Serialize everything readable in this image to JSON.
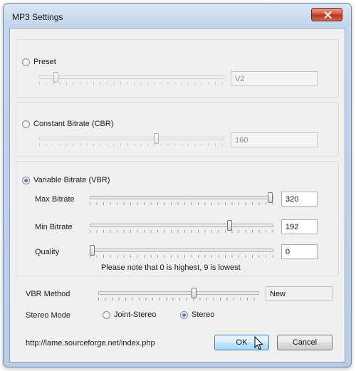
{
  "window": {
    "title": "MP3 Settings"
  },
  "preset": {
    "label": "Preset",
    "value": "V2",
    "slider_level": 0.08,
    "checked": false
  },
  "cbr": {
    "label": "Constant Bitrate (CBR)",
    "value": "160",
    "slider_level": 0.64,
    "checked": false
  },
  "vbr": {
    "label": "Variable Bitrate (VBR)",
    "checked": true,
    "max_bitrate": {
      "label": "Max Bitrate",
      "value": "320",
      "slider_level": 1.0
    },
    "min_bitrate": {
      "label": "Min Bitrate",
      "value": "192",
      "slider_level": 0.77
    },
    "quality": {
      "label": "Quality",
      "value": "0",
      "slider_level": 0.0
    },
    "note": "Please note that 0 is highest, 9 is lowest"
  },
  "vbr_method": {
    "label": "VBR Method",
    "value": "New",
    "slider_level": 0.6
  },
  "stereo_mode": {
    "label": "Stereo Mode",
    "options": [
      {
        "label": "Joint-Stereo",
        "checked": false
      },
      {
        "label": "Stereo",
        "checked": true
      }
    ]
  },
  "footer": {
    "link": "http://lame.sourceforge.net/index.php",
    "ok_label": "OK",
    "cancel_label": "Cancel"
  },
  "icons": [
    "close-icon",
    "radio-icon",
    "mouse-pointer-icon"
  ],
  "colors": {
    "accent": "#3c7fb1",
    "close_red": "#c7442d"
  }
}
